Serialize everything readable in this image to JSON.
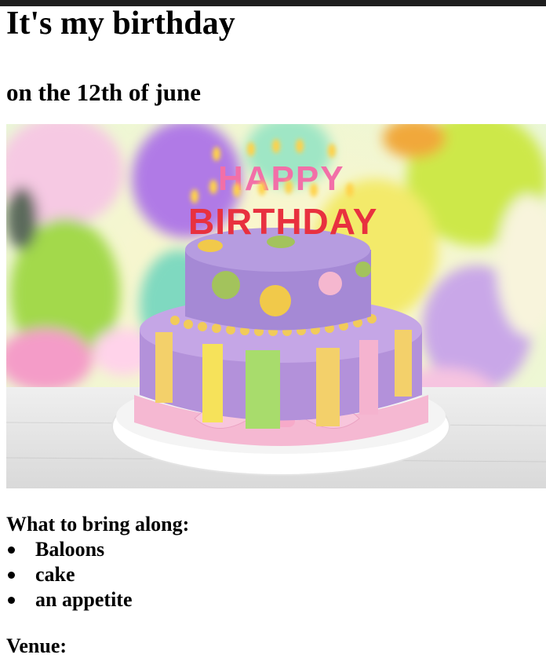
{
  "page": {
    "title": "It's my birthday",
    "subtitle": "on the 12th of june"
  },
  "image": {
    "caption_top": "HAPPY",
    "caption_bottom": "BIRTHDAY"
  },
  "bring": {
    "heading": "What to bring along:",
    "items": [
      "Baloons",
      "cake",
      "an appetite"
    ]
  },
  "venue": {
    "heading": "Venue:"
  },
  "colors": {
    "topbar": "#1e1e1e",
    "text": "#000000",
    "cake_top": "#a78ad6",
    "cake_stripes": "#f0c85a"
  }
}
